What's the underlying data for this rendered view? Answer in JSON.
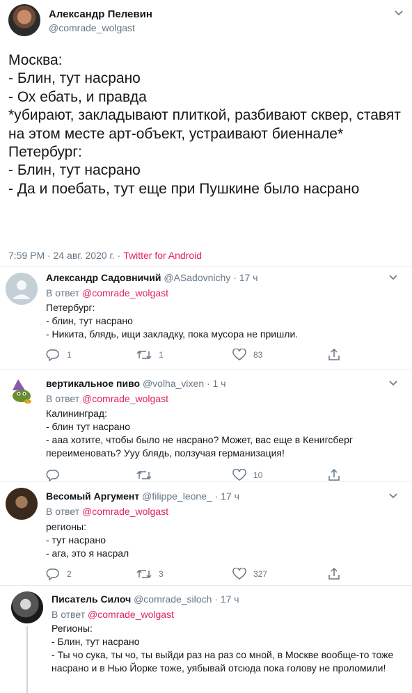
{
  "main_tweet": {
    "author_name": "Александр Пелевин",
    "author_handle": "@comrade_wolgast",
    "text": "Москва:\n- Блин, тут насрано\n- Ох ебать, и правда\n*убирают, закладывают плиткой, разбивают сквер, ставят на этом месте арт-объект, устраивают биеннале*\nПетербург:\n- Блин, тут насрано\n- Да и поебать, тут еще при Пушкине было насрано",
    "timestamp": "7:59 PM · 24 авг. 2020 г. · ",
    "source": "Twitter for Android"
  },
  "reply_label": "В ответ",
  "reply_to": "@comrade_wolgast",
  "replies": [
    {
      "name": "Александр Садовничий",
      "handle": "@ASadovnichy · 17 ч",
      "text": "Петербург:\n- блин, тут насрано\n- Никита, блядь, ищи закладку, пока мусора не пришли.",
      "replies_count": "1",
      "retweets_count": "1",
      "likes_count": "83"
    },
    {
      "name": "вертикальное пиво",
      "handle": "@volha_vixen · 1 ч",
      "text": "Калининград:\n- блин тут насрано\n- ааа хотите, чтобы было не насрано? Может, вас еще в Кенигсберг переименовать? Ууу блядь, ползучая германизация!",
      "replies_count": "",
      "retweets_count": "",
      "likes_count": "10"
    },
    {
      "name": "Весомый Аргумент",
      "handle": "@filippe_leone_ · 17 ч",
      "text": "регионы:\n- тут насрано\n- ага, это я насрал",
      "replies_count": "2",
      "retweets_count": "3",
      "likes_count": "327"
    },
    {
      "name": "Писатель Силоч",
      "handle": "@comrade_siloch · 17 ч",
      "text": "Регионы:\n- Блин, тут насрано\n- Ты чо сука, ты чо, ты выйди раз на раз со мной, в Москве вообще-то тоже насрано и в Нью Йорке тоже, уябывай отсюда пока голову не проломили!"
    }
  ],
  "colors": {
    "accent": "#e0245e",
    "muted": "#657786",
    "text": "#14171a",
    "border": "#e6ecf0"
  }
}
